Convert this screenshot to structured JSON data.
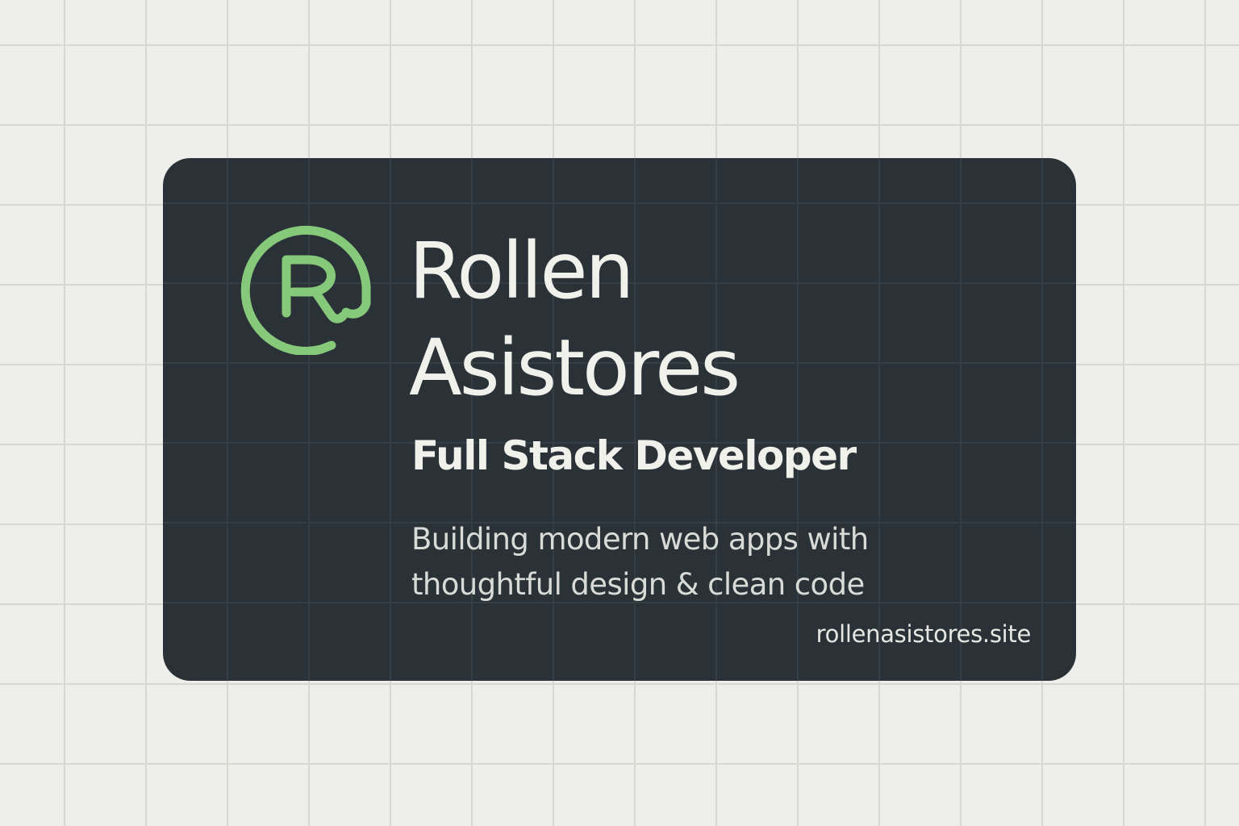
{
  "card": {
    "logo_icon": "r-at-logo-icon",
    "logo_letter": "R",
    "name_first": "Rollen",
    "name_last": "Asistores",
    "role": "Full Stack Developer",
    "tagline_line1": "Building modern web apps with",
    "tagline_line2": "thoughtful design & clean code",
    "website": "rollenasistores.site"
  },
  "colors": {
    "background": "#eeeeea",
    "card": "#2a3137",
    "accent": "#86c97b",
    "text": "#f1f1ec"
  }
}
